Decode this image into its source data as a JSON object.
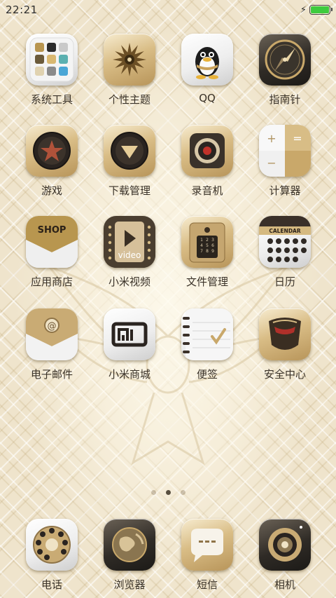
{
  "status_bar": {
    "time": "22:21",
    "charging_icon": "lightning-bolt",
    "battery_level_percent": 100
  },
  "apps": [
    {
      "label": "系统工具",
      "icon": "folder-grid-icon",
      "name": "app-system-tools"
    },
    {
      "label": "个性主题",
      "icon": "flower-theme-icon",
      "name": "app-themes"
    },
    {
      "label": "QQ",
      "icon": "penguin-icon",
      "name": "app-qq"
    },
    {
      "label": "指南针",
      "icon": "compass-icon",
      "name": "app-compass"
    },
    {
      "label": "游戏",
      "icon": "star-game-icon",
      "name": "app-games"
    },
    {
      "label": "下载管理",
      "icon": "download-icon",
      "name": "app-downloads"
    },
    {
      "label": "录音机",
      "icon": "recorder-icon",
      "name": "app-recorder"
    },
    {
      "label": "计算器",
      "icon": "calculator-icon",
      "name": "app-calculator"
    },
    {
      "label": "应用商店",
      "icon": "shop-icon",
      "shop_text": "SHOP",
      "name": "app-store"
    },
    {
      "label": "小米视频",
      "icon": "video-icon",
      "video_text": "video",
      "name": "app-mi-video"
    },
    {
      "label": "文件管理",
      "icon": "file-keypad-icon",
      "name": "app-files"
    },
    {
      "label": "日历",
      "icon": "calendar-icon",
      "calendar_text": "CALENDAR",
      "name": "app-calendar"
    },
    {
      "label": "电子邮件",
      "icon": "mail-icon",
      "name": "app-email"
    },
    {
      "label": "小米商城",
      "icon": "mi-store-icon",
      "name": "app-mi-store"
    },
    {
      "label": "便签",
      "icon": "notepad-icon",
      "name": "app-notes"
    },
    {
      "label": "安全中心",
      "icon": "shield-helmet-icon",
      "name": "app-security"
    }
  ],
  "page_indicator": {
    "count": 3,
    "active_index": 1
  },
  "dock": [
    {
      "label": "电话",
      "icon": "rotary-phone-icon",
      "name": "dock-phone"
    },
    {
      "label": "浏览器",
      "icon": "globe-icon",
      "name": "dock-browser"
    },
    {
      "label": "短信",
      "icon": "message-bubble-icon",
      "name": "dock-messages"
    },
    {
      "label": "相机",
      "icon": "camera-lens-icon",
      "name": "dock-camera"
    }
  ],
  "colors": {
    "accent_gold": "#c9a86a",
    "battery_green": "#3ecb3e",
    "label_text": "#3a3228"
  }
}
